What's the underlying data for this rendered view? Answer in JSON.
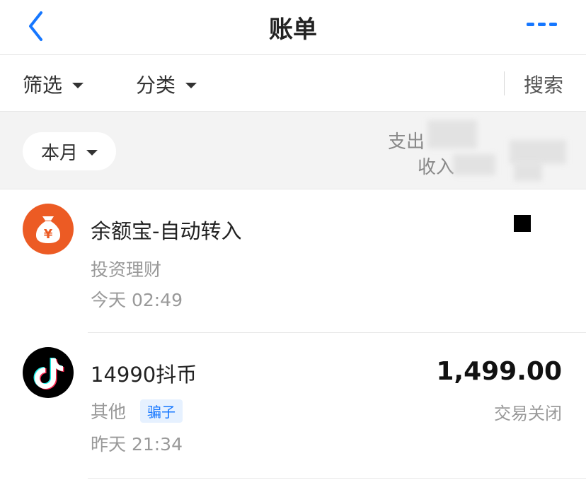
{
  "nav": {
    "title": "账单",
    "back_icon": "chevron-left-icon",
    "more_icon": "more-dots-icon",
    "accent_color": "#1677ff"
  },
  "filter": {
    "filter_label": "筛选",
    "category_label": "分类",
    "search_label": "搜索"
  },
  "summary": {
    "period": "本月",
    "expense_label": "支出",
    "income_label": "收入"
  },
  "transactions": [
    {
      "title": "余额宝-自动转入",
      "category": "投资理财",
      "time": "今天  02:49",
      "icon": "money-bag-icon",
      "icon_color": "#ec5b24"
    },
    {
      "title": "14990抖币",
      "category": "其他",
      "tag": "骗子",
      "time": "昨天  21:34",
      "amount": "1,499.00",
      "status": "交易关闭",
      "icon": "tiktok-icon"
    }
  ]
}
